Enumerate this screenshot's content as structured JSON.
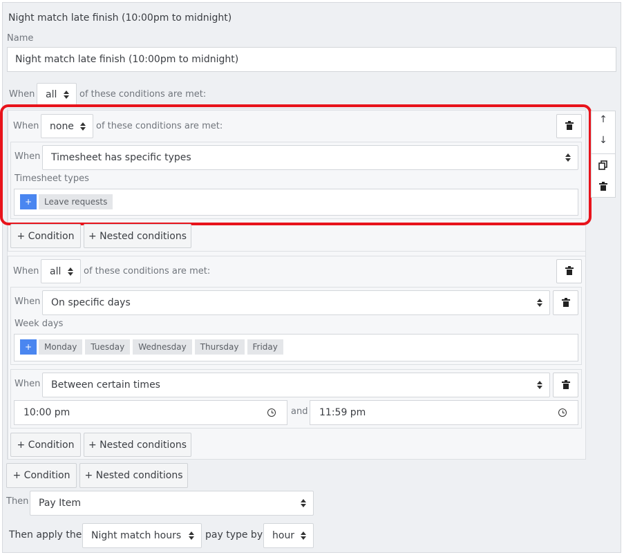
{
  "header": {
    "title": "Night match late finish (10:00pm to midnight)"
  },
  "name_field": {
    "label": "Name",
    "value": "Night match late finish (10:00pm to midnight)"
  },
  "root_group": {
    "when": "When",
    "operator": "all",
    "suffix": "of these conditions are met:"
  },
  "group1": {
    "when": "When",
    "operator": "none",
    "suffix": "of these conditions are met:",
    "condition": {
      "when": "When",
      "type": "Timesheet has specific types",
      "sublabel": "Timesheet types",
      "tags": [
        "Leave requests"
      ],
      "add": "+"
    },
    "add_condition": "+ Condition",
    "add_nested": "+ Nested conditions"
  },
  "side_controls": {
    "up": "↑",
    "down": "↓"
  },
  "group2": {
    "when": "When",
    "operator": "all",
    "suffix": "of these conditions are met:",
    "cond_days": {
      "when": "When",
      "type": "On specific days",
      "sublabel": "Week days",
      "add": "+",
      "tags": [
        "Monday",
        "Tuesday",
        "Wednesday",
        "Thursday",
        "Friday"
      ]
    },
    "cond_times": {
      "when": "When",
      "type": "Between certain times",
      "start": "10:00 pm",
      "and": "and",
      "end": "11:59 pm"
    },
    "add_condition": "+ Condition",
    "add_nested": "+ Nested conditions"
  },
  "root_actions": {
    "add_condition": "+ Condition",
    "add_nested": "+ Nested conditions"
  },
  "then": {
    "label": "Then",
    "value": "Pay Item"
  },
  "apply": {
    "prefix": "Then apply the",
    "pay_type": "Night match hours",
    "middle": "pay type by",
    "unit": "hour"
  },
  "colors": {
    "highlight": "#e8131b",
    "accent": "#4a86f0"
  }
}
